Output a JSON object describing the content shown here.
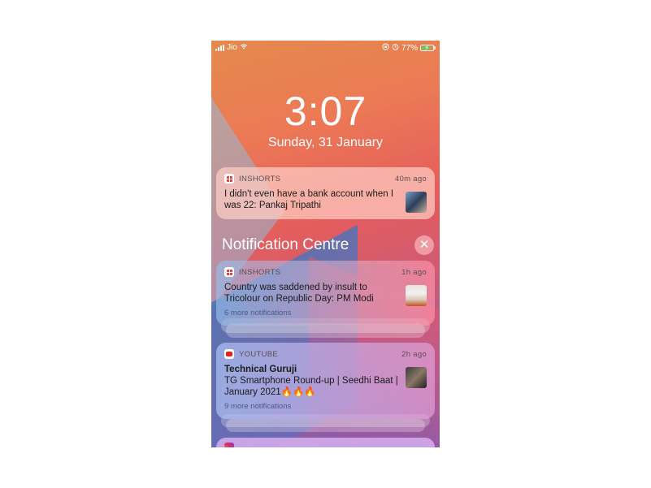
{
  "status_bar": {
    "carrier": "Jio",
    "battery_percent": "77%",
    "battery_level": 0.77
  },
  "lock_screen": {
    "time": "3:07",
    "date": "Sunday, 31 January"
  },
  "notifications_top": [
    {
      "app": "INSHORTS",
      "age": "40m ago",
      "message": "I didn't even have a bank account when I was 22: Pankaj Tripathi"
    }
  ],
  "notification_centre": {
    "title": "Notification Centre",
    "groups": [
      {
        "app": "INSHORTS",
        "age": "1h ago",
        "message": "Country was saddened by insult to Tricolour on Republic Day: PM Modi",
        "more": "6 more notifications"
      },
      {
        "app": "YOUTUBE",
        "age": "2h ago",
        "title": "Technical Guruji",
        "message": "TG Smartphone Round-up | Seedhi Baat | January 2021🔥🔥🔥",
        "more": "9 more notifications"
      }
    ]
  },
  "icons": [
    "signal-icon",
    "wifi-icon",
    "orientation-lock-icon",
    "alarm-icon",
    "battery-icon",
    "inshorts-icon",
    "youtube-icon",
    "close-icon",
    "instagram-icon"
  ],
  "colors": {
    "wallpaper_top": "#e38a4c",
    "wallpaper_bottom": "#7a5fb2",
    "battery_fill": "#4cd964",
    "youtube_red": "#e62117",
    "inshorts_red": "#d9433a"
  }
}
